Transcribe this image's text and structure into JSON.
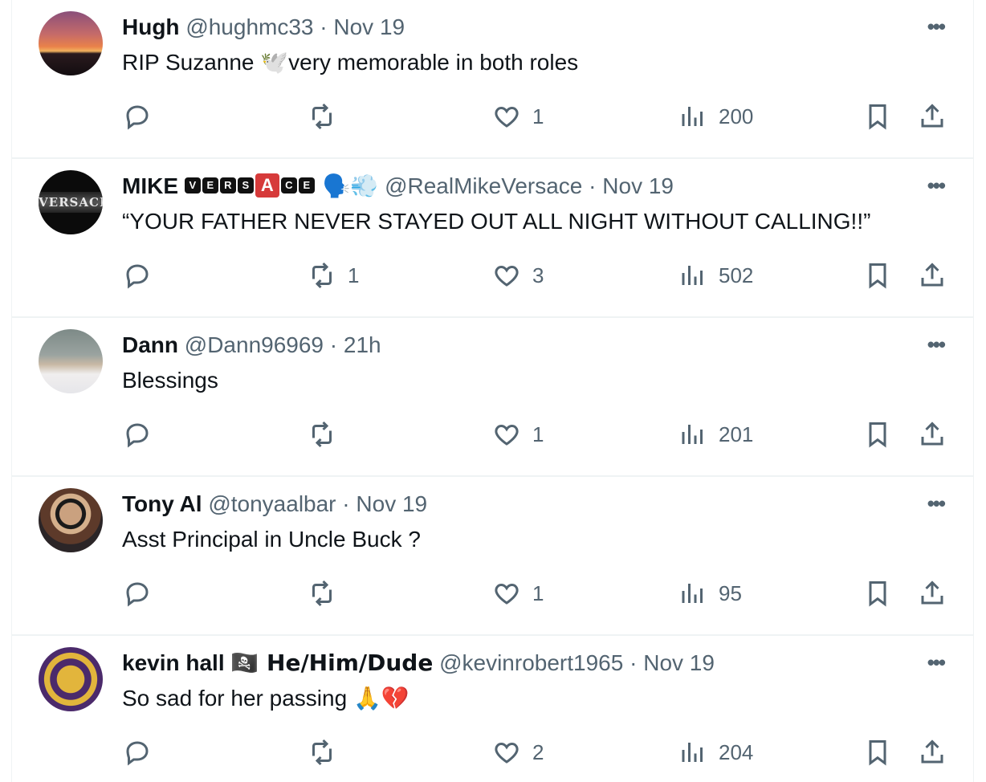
{
  "tweets": [
    {
      "name": "Hugh",
      "handle": "@hughmc33",
      "separator": "·",
      "time": "Nov 19",
      "text": "RIP Suzanne 🕊️very memorable in both roles",
      "replies": "",
      "reposts": "",
      "likes": "1",
      "views": "200"
    },
    {
      "name": "MIKE",
      "name_badges": [
        "V",
        "E",
        "R",
        "S",
        "A",
        "C",
        "E"
      ],
      "name_emoji": "🗣️💨",
      "handle": "@RealMikeVersace",
      "separator": "·",
      "time": "Nov 19",
      "avatar_text": "VERSACE",
      "text": "“YOUR FATHER NEVER STAYED OUT ALL NIGHT WITHOUT CALLING!!”",
      "replies": "",
      "reposts": "1",
      "likes": "3",
      "views": "502"
    },
    {
      "name": "Dann",
      "handle": "@Dann96969",
      "separator": "·",
      "time": "21h",
      "text": "Blessings",
      "replies": "",
      "reposts": "",
      "likes": "1",
      "views": "201"
    },
    {
      "name": "Tony Al",
      "handle": "@tonyaalbar",
      "separator": "·",
      "time": "Nov 19",
      "text": "Asst Principal in Uncle Buck ?",
      "replies": "",
      "reposts": "",
      "likes": "1",
      "views": "95"
    },
    {
      "name": "kevin hall",
      "name_extra": "🏴‍☠️ He/Him/Dude",
      "handle": "@kevinrobert1965",
      "separator": "·",
      "time": "Nov 19",
      "text": "So sad for her passing 🙏💔",
      "replies": "",
      "reposts": "",
      "likes": "2",
      "views": "204"
    }
  ],
  "more_label": "•••",
  "icons": {
    "reply": "reply-icon",
    "repost": "repost-icon",
    "like": "heart-icon",
    "views": "views-icon",
    "bookmark": "bookmark-icon",
    "share": "share-icon"
  }
}
